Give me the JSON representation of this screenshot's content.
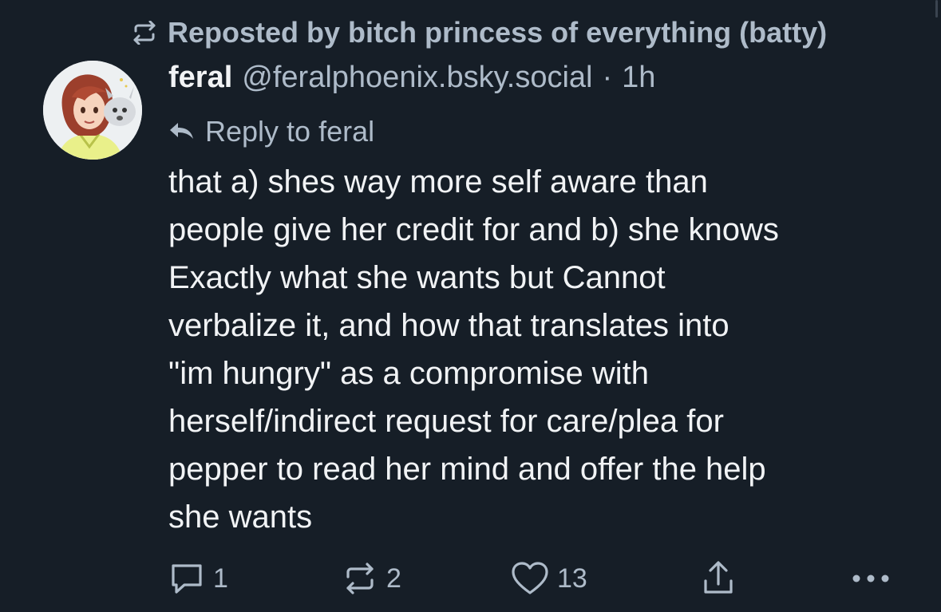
{
  "repost": {
    "text": "Reposted by bitch princess of everything (batty)",
    "icon": "repost-icon"
  },
  "post": {
    "author_name": "feral",
    "author_handle": "@feralphoenix.bsky.social",
    "separator": "·",
    "time": "1h",
    "avatar": "avatar",
    "reply_to": "Reply to feral",
    "reply_icon": "reply-arrow-icon",
    "body_lines": [
      "that a) shes way more self aware than",
      "people give her credit for and b) she knows",
      "Exactly what she wants but Cannot",
      "verbalize it, and how that translates into",
      "\"im hungry\" as a compromise with",
      "herself/indirect request for care/plea for",
      "pepper to read her mind and offer the help",
      "she wants"
    ]
  },
  "actions": {
    "reply": {
      "icon": "comment-icon",
      "count": "1"
    },
    "repost": {
      "icon": "repost-icon",
      "count": "2"
    },
    "like": {
      "icon": "heart-icon",
      "count": "13"
    },
    "share": {
      "icon": "share-icon"
    },
    "more": {
      "icon": "more-dots-icon"
    }
  },
  "colors": {
    "background": "#161e27",
    "text": "#f1f3f5",
    "muted": "#aebbc9"
  }
}
